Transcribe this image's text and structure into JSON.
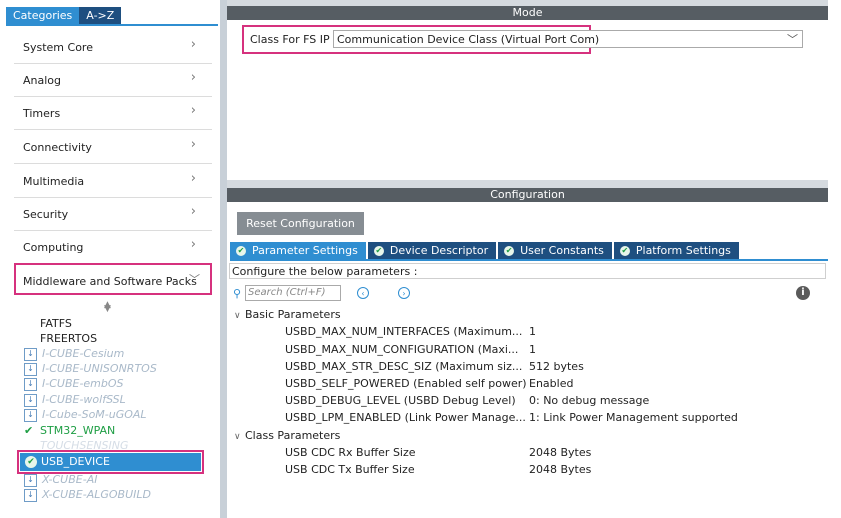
{
  "left_panel": {
    "tabs": [
      "Categories",
      "A->Z"
    ],
    "categories": [
      "System Core",
      "Analog",
      "Timers",
      "Connectivity",
      "Multimedia",
      "Security",
      "Computing",
      "Middleware and Software Packs"
    ],
    "packs": [
      {
        "label": "FATFS",
        "style": "plain"
      },
      {
        "label": "FREERTOS",
        "style": "plain"
      },
      {
        "label": "I-CUBE-Cesium",
        "style": "dim"
      },
      {
        "label": "I-CUBE-UNISONRTOS",
        "style": "dim"
      },
      {
        "label": "I-CUBE-embOS",
        "style": "dim"
      },
      {
        "label": "I-CUBE-wolfSSL",
        "style": "dim"
      },
      {
        "label": "I-Cube-SoM-uGOAL",
        "style": "dim"
      },
      {
        "label": "STM32_WPAN",
        "style": "ok"
      },
      {
        "label": "TOUCHSENSING",
        "style": "faded"
      },
      {
        "label": "USB_DEVICE",
        "style": "selected"
      },
      {
        "label": "X-CUBE-AI",
        "style": "dim"
      },
      {
        "label": "X-CUBE-ALGOBUILD",
        "style": "dim"
      }
    ]
  },
  "mode": {
    "header": "Mode",
    "class_label": "Class For FS IP",
    "class_value": "Communication Device Class (Virtual Port Com)"
  },
  "configuration": {
    "header": "Configuration",
    "reset_button": "Reset Configuration",
    "tabs": [
      "Parameter Settings",
      "Device Descriptor",
      "User Constants",
      "Platform Settings"
    ],
    "configure_text": "Configure the below parameters :",
    "search_placeholder": "Search (Ctrl+F)",
    "groups": [
      {
        "name": "Basic Parameters",
        "params": [
          {
            "name": "USBD_MAX_NUM_INTERFACES (Maximum...",
            "value": "1"
          },
          {
            "name": "USBD_MAX_NUM_CONFIGURATION (Maxi...",
            "value": "1"
          },
          {
            "name": "USBD_MAX_STR_DESC_SIZ (Maximum siz...",
            "value": "512 bytes"
          },
          {
            "name": "USBD_SELF_POWERED (Enabled self power)",
            "value": "Enabled"
          },
          {
            "name": "USBD_DEBUG_LEVEL (USBD Debug Level)",
            "value": "0: No debug message"
          },
          {
            "name": "USBD_LPM_ENABLED (Link Power Manage...",
            "value": "1: Link Power Management supported"
          }
        ]
      },
      {
        "name": "Class Parameters",
        "params": [
          {
            "name": "USB CDC Rx Buffer Size",
            "value": "2048 Bytes"
          },
          {
            "name": "USB CDC Tx Buffer Size",
            "value": "2048 Bytes"
          }
        ]
      }
    ]
  },
  "colors": {
    "accent": "#2f8ed1",
    "tab_dark": "#1e4f80",
    "highlight": "#d6317e",
    "header_bg": "#565d63",
    "ok_green": "#1e9e44"
  }
}
